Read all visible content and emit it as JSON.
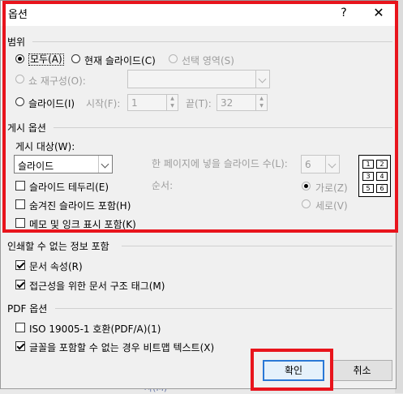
{
  "background": {
    "partial_text": "사(M)"
  },
  "dialog": {
    "title": "옵션",
    "help_label": "?",
    "close_label": "✕"
  },
  "range": {
    "section_label": "범위",
    "all_label": "모두(A)",
    "current_slide_label": "현재 슬라이드(C)",
    "selection_label": "선택 영역(S)",
    "custom_show_label": "쇼 재구성(O):",
    "custom_show_value": "",
    "slides_label": "슬라이드(I)",
    "from_label": "시작(F):",
    "from_value": "1",
    "to_label": "끝(T):",
    "to_value": "32"
  },
  "publish": {
    "section_label": "게시 옵션",
    "publish_what_label": "게시 대상(W):",
    "publish_what_value": "슬라이드",
    "slides_per_page_label": "한 페이지에 넣을 슬라이드 수(L):",
    "slides_per_page_value": "6",
    "order_label": "순서:",
    "horizontal_label": "가로(Z)",
    "vertical_label": "세로(V)",
    "frame_slides_label": "슬라이드 테두리(E)",
    "include_hidden_label": "숨겨진 슬라이드 포함(H)",
    "include_comments_label": "메모 및 잉크 표시 포함(K)",
    "frame_slides_checked": false,
    "include_hidden_checked": false,
    "include_comments_checked": false,
    "preview_numbers": [
      "1",
      "2",
      "3",
      "4",
      "5",
      "6"
    ]
  },
  "nonprinting": {
    "section_label": "인쇄할 수 없는 정보 포함",
    "doc_properties_label": "문서 속성(R)",
    "doc_properties_checked": true,
    "accessibility_tags_label": "접근성을 위한 문서 구조 태그(M)",
    "accessibility_tags_checked": true
  },
  "pdf": {
    "section_label": "PDF 옵션",
    "iso_label": "ISO 19005-1 호환(PDF/A)(1)",
    "iso_checked": false,
    "bitmap_label": "글꼴을 포함할 수 없는 경우 비트맵 텍스트(X)",
    "bitmap_checked": true
  },
  "buttons": {
    "ok_label": "확인",
    "cancel_label": "취소"
  },
  "colors": {
    "highlight_red": "#e8141c",
    "default_button_border": "#2a78d6"
  }
}
